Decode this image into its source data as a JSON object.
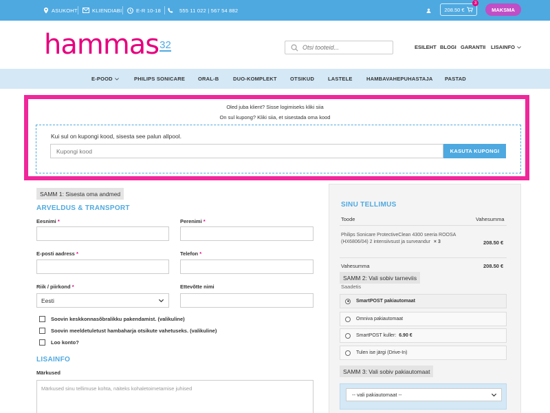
{
  "topbar": {
    "location": "ASUKOHT",
    "support": "KLIENDIABI",
    "hours": "E-R 10-18",
    "phone": "555 11 022 | 567 54 882",
    "cart_total": "208.50 €",
    "cart_count": "3",
    "checkout": "MAKSMA"
  },
  "header": {
    "logo_text": "hammas",
    "logo_num": "32",
    "search_placeholder": "Otsi tooteid...",
    "nav": [
      "ESILEHT",
      "BLOGI",
      "GARANTII",
      "LISAINFO"
    ]
  },
  "menu": [
    "E-POOD",
    "PHILIPS SONICARE",
    "ORAL-B",
    "DUO-KOMPLEKT",
    "OTSIKUD",
    "LASTELE",
    "HAMBAVAHEPUHASTAJA",
    "PASTAD"
  ],
  "coupon": {
    "login_notice": "Oled juba klient? Sisse logimiseks kliki siia",
    "coupon_notice": "On sul kupong? Kliki siia, et sisestada oma kood",
    "description": "Kui sul on kupongi kood, sisesta see palun allpool.",
    "placeholder": "Kupongi kood",
    "button": "KASUTA KUPONGI"
  },
  "form": {
    "step1": "SAMM 1: Sisesta oma andmed",
    "billing_title": "ARVELDUS & TRANSPORT",
    "first_name": "Eesnimi",
    "last_name": "Perenimi",
    "email": "E-posti aadress",
    "phone": "Telefon",
    "country": "Riik / piirkond",
    "country_value": "Eesti",
    "company": "Ettevõtte nimi",
    "required_mark": "*",
    "checkboxes": [
      "Soovin keskkonnasõbralikku pakendamist. (valikuline)",
      "Soovin meeldetuletust hambaharja otsikute vahetuseks. (valikuline)",
      "Loo konto?"
    ],
    "extra_title": "LISAINFO",
    "notes_label": "Märkused",
    "notes_placeholder": "Märkused sinu tellimuse kohta, näiteks kohaletoimetamise juhised"
  },
  "order": {
    "title": "SINU TELLIMUS",
    "col_product": "Toode",
    "col_subtotal": "Vahesumma",
    "product_name": "Philips Sonicare ProtectiveClean 4300 seeria ROOSA (HX6806/04) 2 intensiivsust ja surveandur",
    "product_qty": "× 3",
    "product_price": "208.50 €",
    "subtotal_label": "Vahesumma",
    "subtotal_value": "208.50 €",
    "step2": "SAMM 2: Vali sobiv tarneviis",
    "shipping_label": "Saadetis",
    "shipping_options": [
      {
        "label": "SmartPOST pakiautomaat",
        "price": "",
        "selected": true
      },
      {
        "label": "Omniva pakiautomaat",
        "price": "",
        "selected": false
      },
      {
        "label": "SmartPOST kuller:",
        "price": "6.90 €",
        "selected": false
      },
      {
        "label": "Tulen ise järgi (Drive-In)",
        "price": "",
        "selected": false
      }
    ],
    "step3": "SAMM 3: Vali sobiv pakiautomaat",
    "parcel_select": "-- vali pakiautomaat --"
  },
  "colors": {
    "brand_pink": "#e6007e",
    "brand_blue": "#4ea9e0",
    "highlight": "#f0269b",
    "checkout_button": "#c04ec6"
  }
}
